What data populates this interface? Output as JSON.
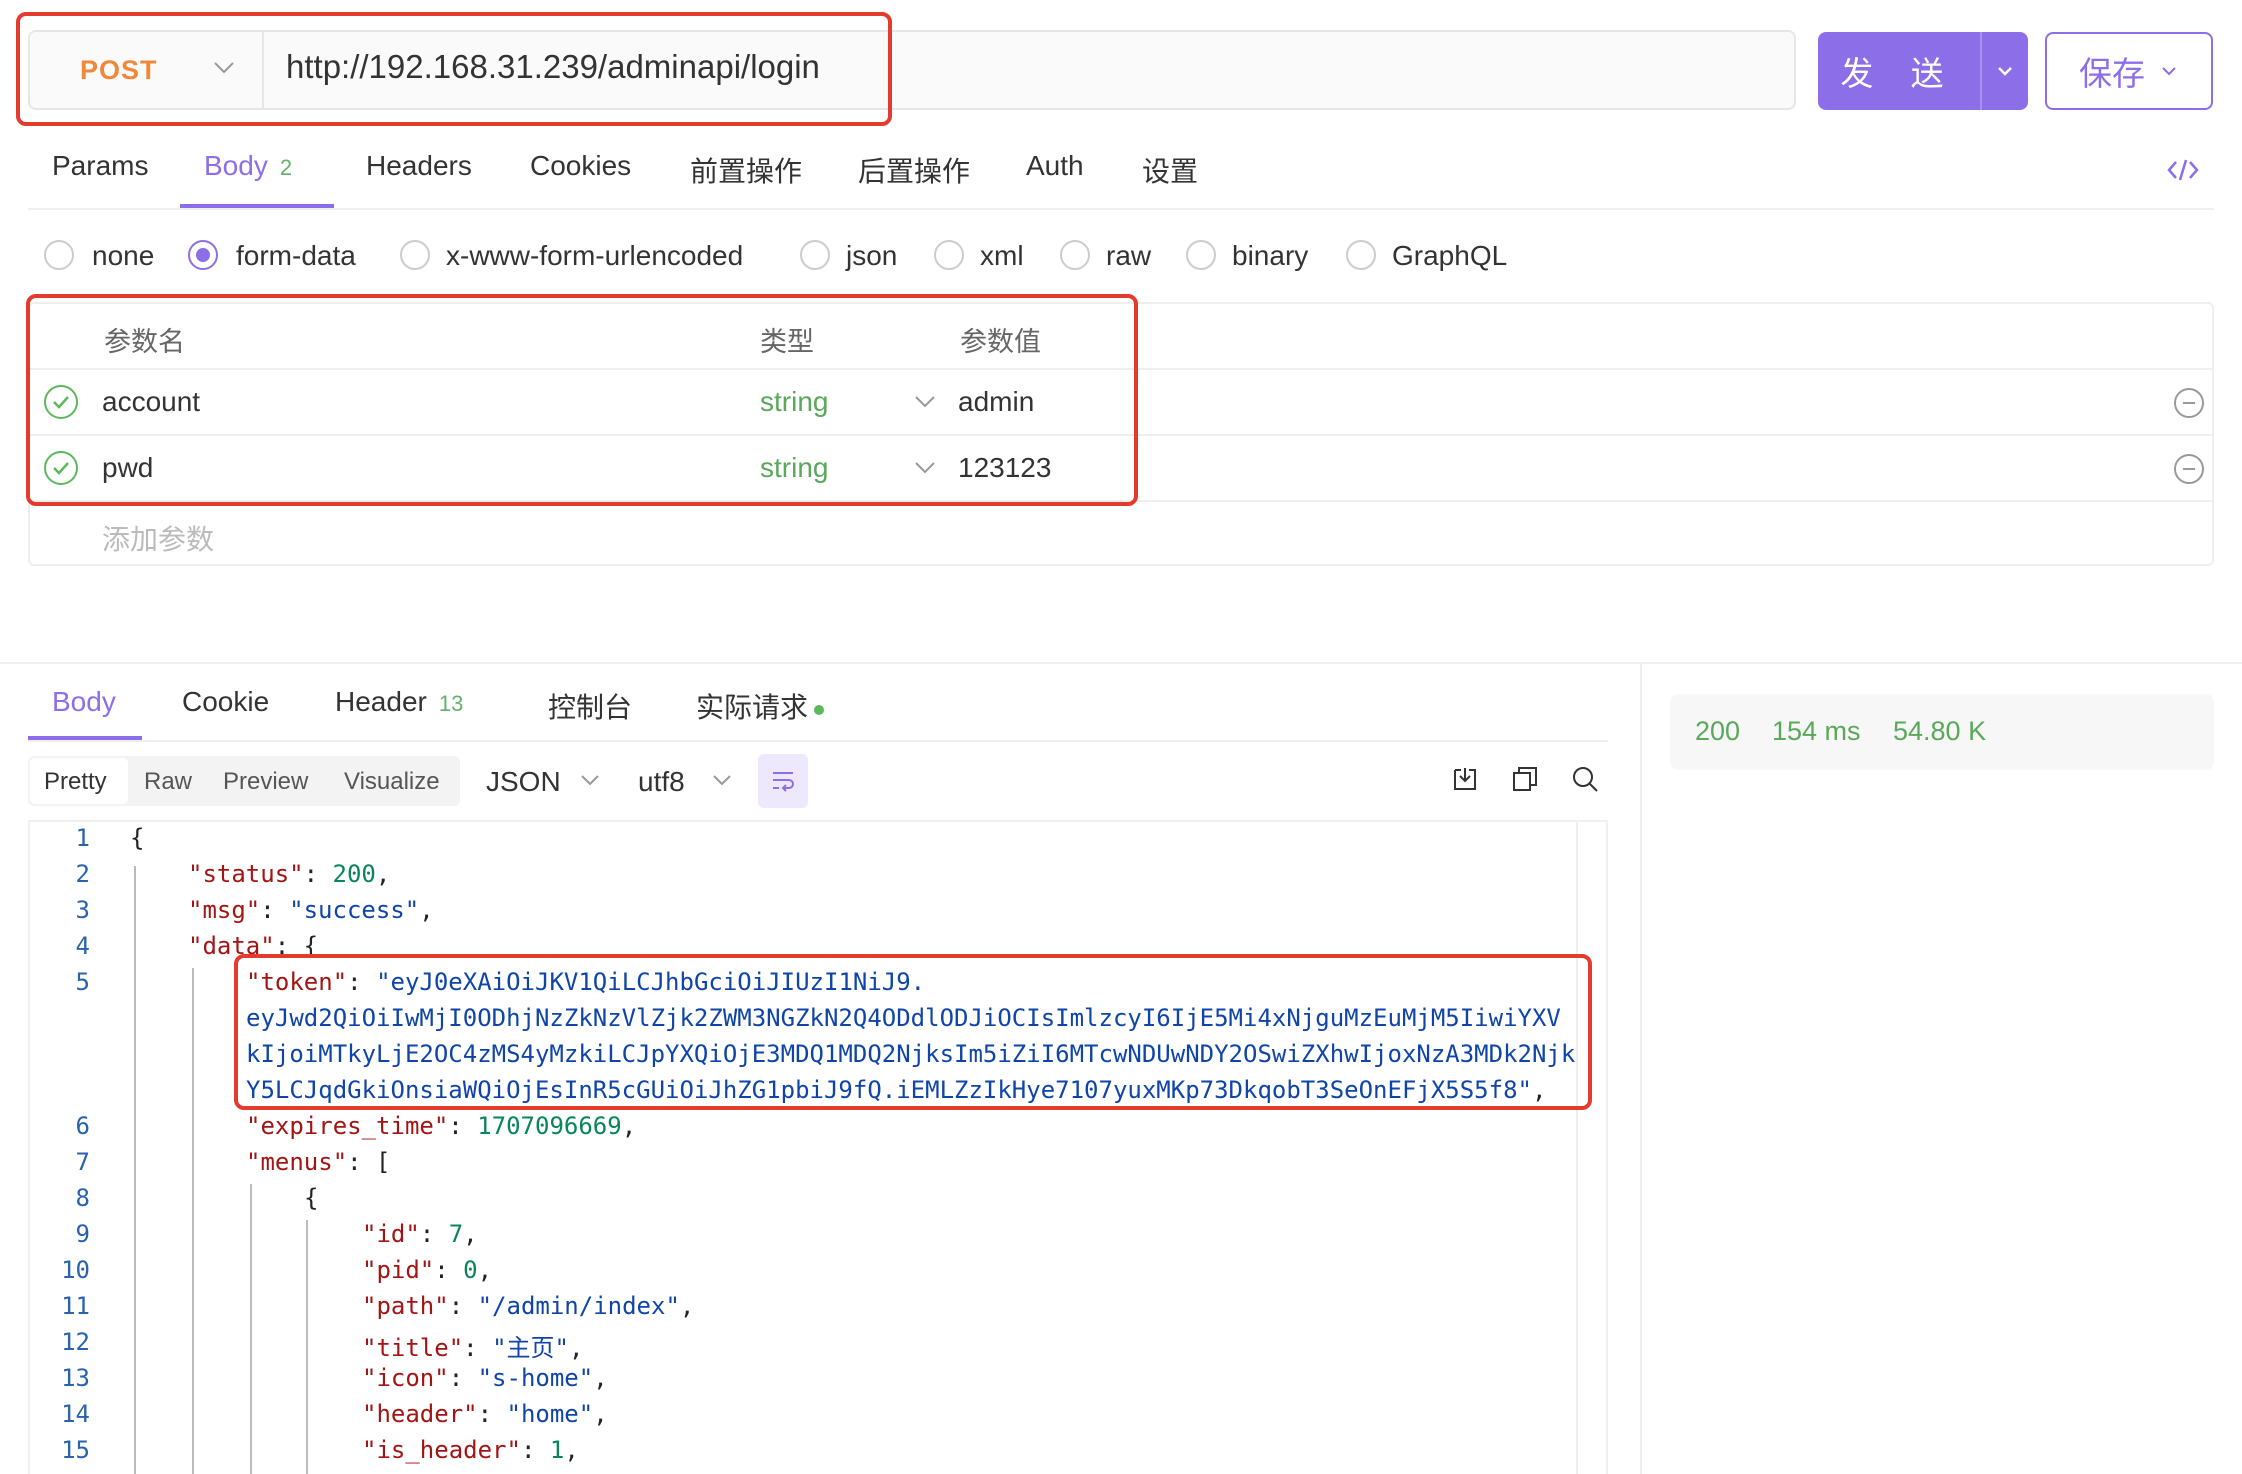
{
  "request": {
    "method": "POST",
    "url": "http://192.168.31.239/adminapi/login",
    "send_label": "发 送",
    "save_label": "保存"
  },
  "request_tabs": [
    {
      "label": "Params"
    },
    {
      "label": "Body",
      "badge": "2"
    },
    {
      "label": "Headers"
    },
    {
      "label": "Cookies"
    },
    {
      "label": "前置操作"
    },
    {
      "label": "后置操作"
    },
    {
      "label": "Auth"
    },
    {
      "label": "设置"
    }
  ],
  "body_types": [
    "none",
    "form-data",
    "x-www-form-urlencoded",
    "json",
    "xml",
    "raw",
    "binary",
    "GraphQL"
  ],
  "body_type_selected": "form-data",
  "params_table": {
    "headers": [
      "参数名",
      "类型",
      "参数值"
    ],
    "rows": [
      {
        "name": "account",
        "type": "string",
        "value": "admin"
      },
      {
        "name": "pwd",
        "type": "string",
        "value": "123123"
      }
    ],
    "add_placeholder": "添加参数"
  },
  "response_tabs": [
    {
      "label": "Body"
    },
    {
      "label": "Cookie"
    },
    {
      "label": "Header",
      "badge": "13"
    },
    {
      "label": "控制台"
    },
    {
      "label": "实际请求"
    }
  ],
  "view_modes": [
    "Pretty",
    "Raw",
    "Preview",
    "Visualize"
  ],
  "format_select": "JSON",
  "encoding_select": "utf8",
  "status": {
    "code": "200",
    "time": "154 ms",
    "size": "54.80 K"
  },
  "code": {
    "line_numbers": [
      "1",
      "2",
      "3",
      "4",
      "5",
      "6",
      "7",
      "8",
      "9",
      "10",
      "11",
      "12",
      "13",
      "14",
      "15"
    ],
    "open_brace": "{",
    "status_key": "\"status\"",
    "status_val": "200",
    "msg_key": "\"msg\"",
    "msg_val": "\"success\"",
    "data_key": "\"data\"",
    "token_key": "\"token\"",
    "token_line1": "\"eyJ0eXAiOiJKV1QiLCJhbGciOiJIUzI1NiJ9.",
    "token_line2": "eyJwd2QiOiIwMjI0ODhjNzZkNzVlZjk2ZWM3NGZkN2Q4ODdlODJiOCIsImlzcyI6IjE5Mi4xNjguMzEuMjM5IiwiYXV",
    "token_line3": "kIjoiMTkyLjE2OC4zMS4yMzkiLCJpYXQiOjE3MDQ1MDQ2NjksIm5iZiI6MTcwNDUwNDY2OSwiZXhwIjoxNzA3MDk2Njk",
    "token_line4": "Y5LCJqdGkiOnsiaWQiOjEsInR5cGUiOiJhZG1pbiJ9fQ.iEMLZzIkHye7107yuxMKp73DkqobT3SeOnEFjX5S5f8\"",
    "expires_key": "\"expires_time\"",
    "expires_val": "1707096669",
    "menus_key": "\"menus\"",
    "id_key": "\"id\"",
    "id_val": "7",
    "pid_key": "\"pid\"",
    "pid_val": "0",
    "path_key": "\"path\"",
    "path_val": "\"/admin/index\"",
    "title_key": "\"title\"",
    "title_val": "\"主页\"",
    "icon_key": "\"icon\"",
    "icon_val": "\"s-home\"",
    "header_key": "\"header\"",
    "header_val": "\"home\"",
    "is_header_key": "\"is_header\"",
    "is_header_val": "1"
  },
  "colors": {
    "accent": "#8c6fe8",
    "method": "#f0883a",
    "highlight": "#e33b2e",
    "success": "#5aa85a"
  }
}
